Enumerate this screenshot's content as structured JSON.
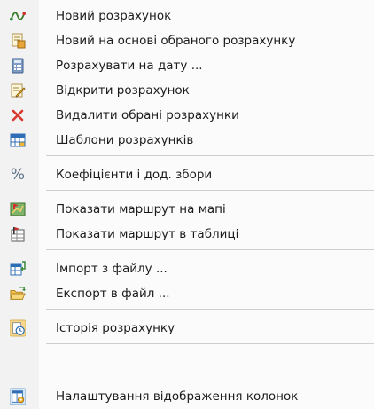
{
  "menu": {
    "items": [
      {
        "label": "Новий розрахунок",
        "icon": "route-curve-icon"
      },
      {
        "label": "Новий на основі обраного розрахунку",
        "icon": "document-copy-icon"
      },
      {
        "label": "Розрахувати на дату ...",
        "icon": "calculator-icon"
      },
      {
        "label": "Відкрити розрахунок",
        "icon": "document-edit-icon"
      },
      {
        "label": "Видалити обрані розрахунки",
        "icon": "delete-icon"
      },
      {
        "label": "Шаблони розрахунків",
        "icon": "table-templates-icon"
      },
      {
        "label": "Коефіцієнти і дод. збори",
        "icon": "percent-icon",
        "glyph": "%"
      },
      {
        "label": "Показати маршрут на мапі",
        "icon": "map-route-icon"
      },
      {
        "label": "Показати маршрут в таблиці",
        "icon": "table-route-icon"
      },
      {
        "label": "Імпорт з файлу ...",
        "icon": "import-icon"
      },
      {
        "label": "Експорт в файл ...",
        "icon": "folder-export-icon"
      },
      {
        "label": "Історія розрахунку",
        "icon": "history-icon"
      },
      {
        "label": "Налаштування відображення колонок",
        "icon": "column-settings-icon"
      }
    ]
  },
  "colors": {
    "gutter": "#f2f2f2",
    "separator": "#cfcfcf",
    "delete": "#d9382f",
    "history_highlight": "#f6d98f"
  }
}
